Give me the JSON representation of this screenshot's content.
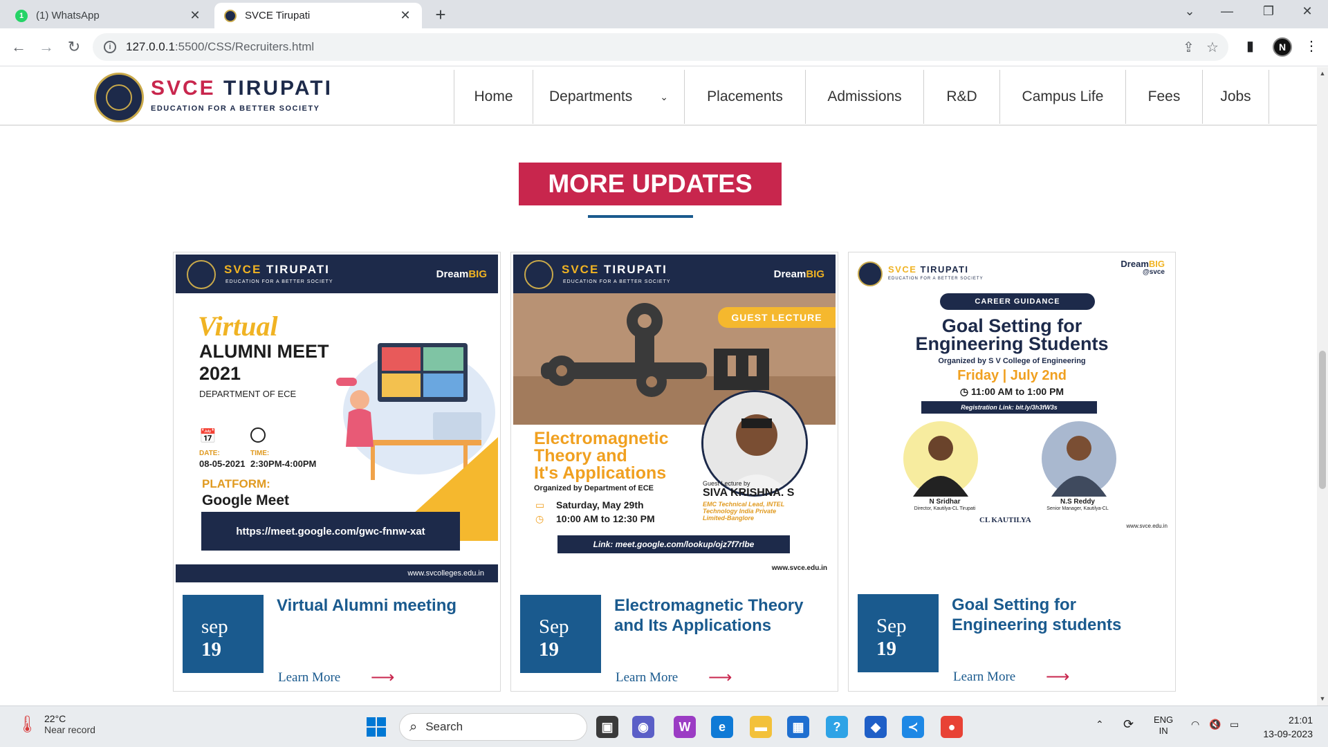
{
  "browser": {
    "tabs": [
      {
        "title": "(1) WhatsApp",
        "badge": "1",
        "active": false
      },
      {
        "title": "SVCE Tirupati",
        "active": true
      }
    ],
    "new_tab": "+",
    "url_host": "127.0.0.1",
    "url_path": ":5500/CSS/Recruiters.html",
    "profile_initial": "N"
  },
  "site": {
    "logo_name_1": "SVCE",
    "logo_name_2": "TIRUPATI",
    "logo_tagline": "EDUCATION FOR A BETTER SOCIETY",
    "nav": [
      "Home",
      "Departments",
      "Placements",
      "Admissions",
      "R&D",
      "Campus Life",
      "Fees",
      "Jobs"
    ],
    "section_title": "MORE UPDATES"
  },
  "poster_brand": {
    "name_1": "SVCE",
    "name_2": "TIRUPATI",
    "tagline": "EDUCATION FOR A BETTER SOCIETY",
    "dream": "Dream",
    "big": "BIG"
  },
  "posters": {
    "p1": {
      "script": "Virtual",
      "heading_1": "ALUMNI MEET",
      "heading_2": "2021",
      "dept": "DEPARTMENT OF ECE",
      "date_label": "DATE:",
      "date": "08-05-2021",
      "time_label": "TIME:",
      "time": "2:30PM-4:00PM",
      "platform_label": "PLATFORM:",
      "platform": "Google Meet",
      "link": "https://meet.google.com/gwc-fnnw-xat",
      "site": "www.svcolleges.edu.in"
    },
    "p2": {
      "badge": "GUEST LECTURE",
      "title_1": "Electromagnetic",
      "title_2": "Theory and",
      "title_3": "It's Applications",
      "org": "Organized by Department of ECE",
      "date": "Saturday, May 29th",
      "time": "10:00 AM to 12:30 PM",
      "lecturer_label": "Guest Lecture by",
      "lecturer": "SIVA KRISHNA. S",
      "lecturer_role_1": "EMC Technical Lead, INTEL",
      "lecturer_role_2": "Technology India Private",
      "lecturer_role_3": "Limited-Banglore",
      "link": "Link: meet.google.com/lookup/ojz7f7rlbe",
      "site": "www.svce.edu.in"
    },
    "p3": {
      "dream_sub": "@svce",
      "pill": "CAREER GUIDANCE",
      "title_1": "Goal Setting for",
      "title_2": "Engineering Students",
      "org": "Organized by S V College of Engineering",
      "date": "Friday | July 2nd",
      "time": "11:00 AM to 1:00 PM",
      "reg": "Registration Link: bit.ly/3h3fW3s",
      "sp1_name": "N Sridhar",
      "sp1_role": "Director, Kautilya-CL Tirupati",
      "sp2_name": "N.S Reddy",
      "sp2_role": "Senior Manager, Kautilya-CL",
      "logo": "CL KAUTILYA",
      "site": "www.svce.edu.in"
    }
  },
  "cards": [
    {
      "month": "sep",
      "day": "19",
      "title": "Virtual Alumni meeting",
      "learn": "Learn More",
      "arrow": "⟶"
    },
    {
      "month": "Sep",
      "day": "19",
      "title": "Electromagnetic Theory and Its Applications",
      "learn": "Learn More",
      "arrow": "⟶"
    },
    {
      "month": "Sep",
      "day": "19",
      "title": "Goal Setting for Engineering students",
      "learn": "Learn More",
      "arrow": "⟶"
    }
  ],
  "taskbar": {
    "temp": "22°C",
    "condition": "Near record",
    "search": "Search",
    "lang_1": "ENG",
    "lang_2": "IN",
    "time": "21:01",
    "date": "13-09-2023"
  },
  "colors": {
    "brand_red": "#c8264d",
    "brand_blue": "#1a5a8e",
    "poster_navy": "#1d2a4a",
    "poster_gold": "#f0b323"
  }
}
